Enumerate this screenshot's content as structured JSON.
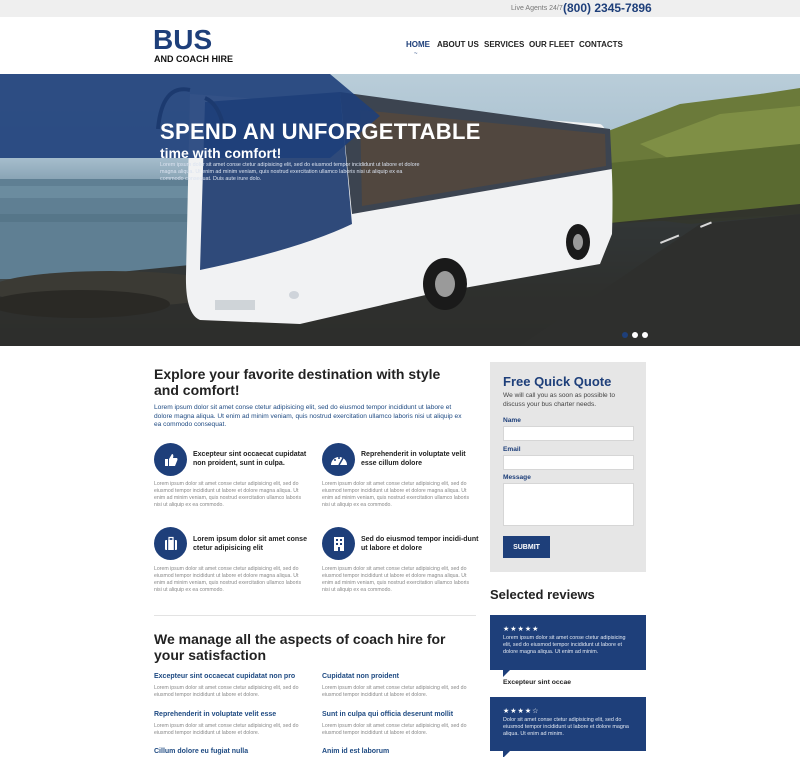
{
  "topbar": {
    "agents_label": "Live Agents 24/7",
    "phone": "(800) 2345-7896"
  },
  "logo": {
    "main": "BUS",
    "sub": "AND COACH HIRE"
  },
  "nav": {
    "items": [
      "HOME",
      "ABOUT US",
      "SERVICES",
      "OUR FLEET",
      "CONTACTS"
    ],
    "active": "HOME",
    "active_mark": "~"
  },
  "hero": {
    "title": "SPEND AN UNFORGETTABLE",
    "subtitle": "time with comfort!",
    "text": "Lorem ipsum dolor sit amet conse ctetur adipisicing elit, sed do eiusmod tempor incididunt ut labore et dolore magna aliqua. Ut enim ad minim veniam, quis nostrud exercitation ullamco laboris nisi ut aliquip ex ea commodo consequat. Duis aute irure dolo.",
    "slides": 3,
    "active_slide": 1
  },
  "intro": {
    "heading": "Explore your favorite destination with style and comfort!",
    "text": "Lorem ipsum dolor sit amet conse ctetur adipisicing elit, sed do eiusmod tempor incididunt ut labore et dolore magna aliqua. Ut enim ad minim veniam, quis nostrud exercitation ullamco laboris nisi ut aliquip ex ea commodo consequat."
  },
  "features": [
    {
      "icon": "thumbs-up-icon",
      "title": "Excepteur sint occaecat cupidatat non proident, sunt in culpa.",
      "text": "Lorem ipsum dolor sit amet conse ctetur adipisicing elit, sed do eiusmod tempor incididunt ut labore et dolore magna aliqua. Ut enim ad minim veniam, quis nostrud exercitation ullamco laboris nisi ut aliquip ex ea commodo."
    },
    {
      "icon": "speedometer-icon",
      "title": "Reprehenderit in voluptate velit esse cillum dolore",
      "text": "Lorem ipsum dolor sit amet conse ctetur adipisicing elit, sed do eiusmod tempor incididunt ut labore et dolore magna aliqua. Ut enim ad minim veniam, quis nostrud exercitation ullamco laboris nisi ut aliquip ex ea commodo."
    },
    {
      "icon": "luggage-icon",
      "title": "Lorem ipsum dolor sit amet conse ctetur adipisicing elit",
      "text": "Lorem ipsum dolor sit amet conse ctetur adipisicing elit, sed do eiusmod tempor incididunt ut labore et dolore magna aliqua. Ut enim ad minim veniam, quis nostrud exercitation ullamco laboris nisi ut aliquip ex ea commodo."
    },
    {
      "icon": "building-icon",
      "title": "Sed do eiusmod tempor incidi-dunt ut labore et dolore",
      "text": "Lorem ipsum dolor sit amet conse ctetur adipisicing elit, sed do eiusmod tempor incididunt ut labore et dolore magna aliqua. Ut enim ad minim veniam, quis nostrud exercitation ullamco laboris nisi ut aliquip ex ea commodo."
    }
  ],
  "manage": {
    "heading": "We manage all the aspects of coach hire for your satisfaction",
    "items": [
      {
        "title": "Excepteur sint occaecat cupidatat non pro",
        "text": "Lorem ipsum dolor sit amet conse ctetur adipisicing elit, sed do eiusmod tempor incididunt ut labore et dolore."
      },
      {
        "title": "Cupidatat non proident",
        "text": "Lorem ipsum dolor sit amet conse ctetur adipisicing elit, sed do eiusmod tempor incididunt ut labore et dolore."
      },
      {
        "title": "Reprehenderit in voluptate velit esse",
        "text": "Lorem ipsum dolor sit amet conse ctetur adipisicing elit, sed do eiusmod tempor incididunt ut labore et dolore."
      },
      {
        "title": "Sunt in culpa qui officia deserunt mollit",
        "text": "Lorem ipsum dolor sit amet conse ctetur adipisicing elit, sed do eiusmod tempor incididunt ut labore et dolore."
      },
      {
        "title": "Cillum dolore eu fugiat nulla",
        "text": ""
      },
      {
        "title": "Anim id est laborum",
        "text": ""
      }
    ]
  },
  "quote": {
    "title": "Free Quick Quote",
    "desc": "We will call you as soon as possible to discuss your bus charter needs.",
    "name_label": "Name",
    "email_label": "Email",
    "message_label": "Message",
    "submit_label": "SUBMIT"
  },
  "reviews": {
    "heading": "Selected reviews",
    "items": [
      {
        "stars": 5,
        "stars_text": "★★★★★",
        "text": "Lorem ipsum dolor sit amet conse ctetur adipisicing elit, sed do eiusmod tempor incididunt ut labore et dolore magna aliqua. Ut enim ad minim.",
        "author": "Excepteur sint occae"
      },
      {
        "stars": 4,
        "stars_text": "★★★★☆",
        "text": "Dolor sit amet conse ctetur adipisicing elit, sed do eiusmod tempor incididunt ut labore et dolore magna aliqua. Ut enim ad minim.",
        "author": ""
      }
    ]
  },
  "colors": {
    "brand": "#1e3f7a",
    "link": "#1e4a82",
    "panel": "#e6e6e6"
  }
}
